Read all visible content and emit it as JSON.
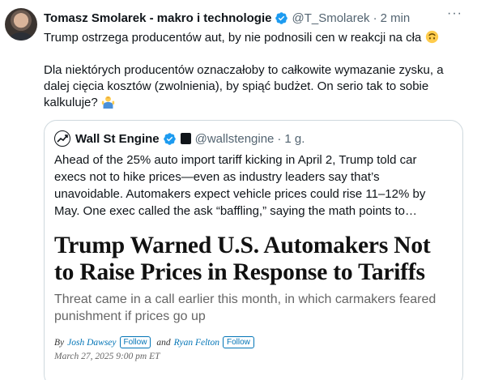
{
  "tweet": {
    "author_name": "Tomasz Smolarek - makro i technologie",
    "handle": "@T_Smolarek",
    "separator": "·",
    "time": "2 min",
    "paragraph1": "Trump ostrzega producentów aut, by nie podnosili cen w reakcji na cła",
    "paragraph2": "Dla niektórych producentów oznaczałoby to całkowite wymazanie zysku, a dalej cięcia kosztów (zwolnienia), by spiąć budżet. On serio tak to sobie kalkuluje?",
    "more_icon": "···"
  },
  "quoted": {
    "name": "Wall St Engine",
    "handle": "@wallstengine",
    "separator": "·",
    "time": "1 g.",
    "text": "Ahead of the 25% auto import tariff kicking in April 2, Trump told car execs not to hike prices—even as industry leaders say that’s unavoidable. Automakers expect vehicle prices could rise 11–12% by May. One exec called the ask “baffling,” saying the math points to…",
    "article": {
      "headline": "Trump Warned U.S. Automakers Not to Raise Prices in Response to Tariffs",
      "subhead": "Threat came in a call earlier this month, in which carmakers feared punishment if prices go up",
      "by": "By",
      "author1": "Josh Dawsey",
      "and": "and",
      "author2": "Ryan Felton",
      "follow_label": "Follow",
      "date": "March 27, 2025 9:00 pm ET"
    }
  },
  "colors": {
    "verified": "#1d9bf0",
    "link": "#0274b6",
    "secondary": "#536471"
  },
  "icons": [
    "verified-badge-icon",
    "upside-down-face-emoji",
    "person-shrugging-emoji",
    "more-icon"
  ]
}
